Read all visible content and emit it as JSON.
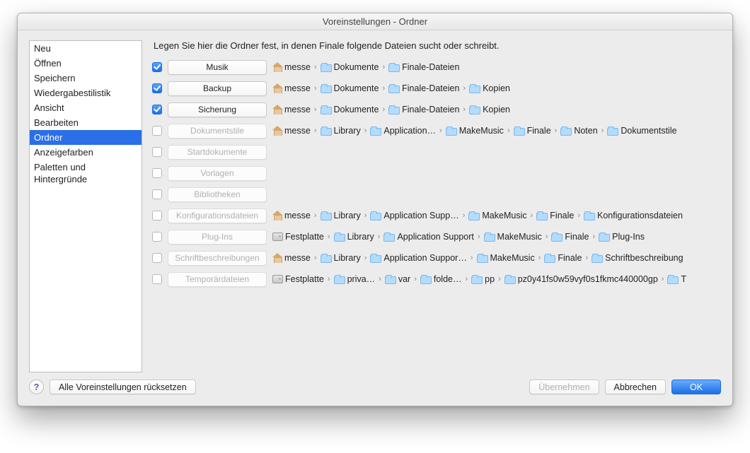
{
  "window": {
    "title": "Voreinstellungen - Ordner"
  },
  "sidebar": {
    "items": [
      {
        "label": "Neu",
        "selected": false
      },
      {
        "label": "Öffnen",
        "selected": false
      },
      {
        "label": "Speichern",
        "selected": false
      },
      {
        "label": "Wiedergabestilistik",
        "selected": false
      },
      {
        "label": "Ansicht",
        "selected": false
      },
      {
        "label": "Bearbeiten",
        "selected": false
      },
      {
        "label": "Ordner",
        "selected": true
      },
      {
        "label": "Anzeigefarben",
        "selected": false
      },
      {
        "label": "Paletten und Hintergründe",
        "selected": false
      }
    ]
  },
  "main": {
    "instructions": "Legen Sie hier die Ordner fest, in denen Finale folgende Dateien sucht oder schreibt.",
    "rows": [
      {
        "checked": true,
        "button": "Musik",
        "path": [
          {
            "icon": "home",
            "label": "messe"
          },
          {
            "icon": "folder",
            "label": "Dokumente"
          },
          {
            "icon": "folder",
            "label": "Finale-Dateien"
          }
        ]
      },
      {
        "checked": true,
        "button": "Backup",
        "path": [
          {
            "icon": "home",
            "label": "messe"
          },
          {
            "icon": "folder",
            "label": "Dokumente"
          },
          {
            "icon": "folder",
            "label": "Finale-Dateien"
          },
          {
            "icon": "folder",
            "label": "Kopien"
          }
        ]
      },
      {
        "checked": true,
        "button": "Sicherung",
        "path": [
          {
            "icon": "home",
            "label": "messe"
          },
          {
            "icon": "folder",
            "label": "Dokumente"
          },
          {
            "icon": "folder",
            "label": "Finale-Dateien"
          },
          {
            "icon": "folder",
            "label": "Kopien"
          }
        ]
      },
      {
        "checked": false,
        "button": "Dokumentstile",
        "path": [
          {
            "icon": "home",
            "label": "messe"
          },
          {
            "icon": "folder",
            "label": "Library"
          },
          {
            "icon": "folder",
            "label": "Application…"
          },
          {
            "icon": "folder",
            "label": "MakeMusic"
          },
          {
            "icon": "folder",
            "label": "Finale"
          },
          {
            "icon": "folder",
            "label": "Noten"
          },
          {
            "icon": "folder",
            "label": "Dokumentstile"
          }
        ]
      },
      {
        "checked": false,
        "button": "Startdokumente",
        "path": []
      },
      {
        "checked": false,
        "button": "Vorlagen",
        "path": []
      },
      {
        "checked": false,
        "button": "Bibliotheken",
        "path": []
      },
      {
        "checked": false,
        "button": "Konfigurationsdateien",
        "path": [
          {
            "icon": "home",
            "label": "messe"
          },
          {
            "icon": "folder",
            "label": "Library"
          },
          {
            "icon": "folder",
            "label": "Application Supp…"
          },
          {
            "icon": "folder",
            "label": "MakeMusic"
          },
          {
            "icon": "folder",
            "label": "Finale"
          },
          {
            "icon": "folder",
            "label": "Konfigurationsdateien"
          }
        ]
      },
      {
        "checked": false,
        "button": "Plug-Ins",
        "path": [
          {
            "icon": "disk",
            "label": "Festplatte"
          },
          {
            "icon": "folder",
            "label": "Library"
          },
          {
            "icon": "folder",
            "label": "Application Support"
          },
          {
            "icon": "folder",
            "label": "MakeMusic"
          },
          {
            "icon": "folder",
            "label": "Finale"
          },
          {
            "icon": "folder",
            "label": "Plug-Ins"
          }
        ]
      },
      {
        "checked": false,
        "button": "Schriftbeschreibungen",
        "path": [
          {
            "icon": "home",
            "label": "messe"
          },
          {
            "icon": "folder",
            "label": "Library"
          },
          {
            "icon": "folder",
            "label": "Application Suppor…"
          },
          {
            "icon": "folder",
            "label": "MakeMusic"
          },
          {
            "icon": "folder",
            "label": "Finale"
          },
          {
            "icon": "folder",
            "label": "Schriftbeschreibung"
          }
        ]
      },
      {
        "checked": false,
        "button": "Temporärdateien",
        "path": [
          {
            "icon": "disk",
            "label": "Festplatte"
          },
          {
            "icon": "folder",
            "label": "priva…"
          },
          {
            "icon": "folder",
            "label": "var"
          },
          {
            "icon": "folder",
            "label": "folde…"
          },
          {
            "icon": "folder",
            "label": "pp"
          },
          {
            "icon": "folder",
            "label": "pz0y41fs0w59vyf0s1fkmc440000gp"
          },
          {
            "icon": "folder",
            "label": "T"
          }
        ]
      }
    ]
  },
  "footer": {
    "help_char": "?",
    "reset_label": "Alle Voreinstellungen rücksetzen",
    "apply_label": "Übernehmen",
    "cancel_label": "Abbrechen",
    "ok_label": "OK"
  }
}
